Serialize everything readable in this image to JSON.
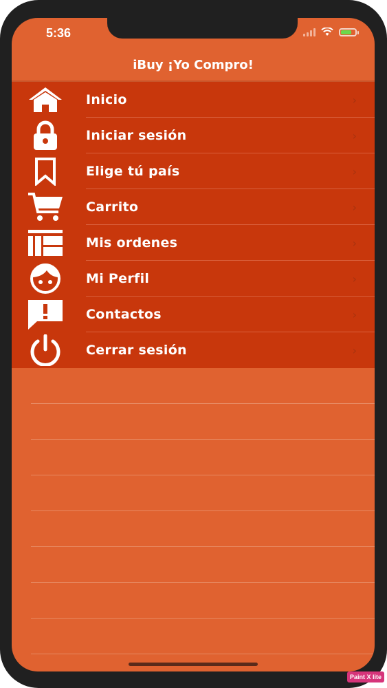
{
  "status_bar": {
    "time": "5:36"
  },
  "nav": {
    "title": "iBuy ¡Yo Compro!"
  },
  "menu": {
    "items": [
      {
        "label": "Inicio",
        "icon": "home-icon"
      },
      {
        "label": "Iniciar sesión",
        "icon": "lock-icon"
      },
      {
        "label": "Elige tú país",
        "icon": "bookmark-icon"
      },
      {
        "label": "Carrito",
        "icon": "cart-icon"
      },
      {
        "label": "Mis ordenes",
        "icon": "orders-icon"
      },
      {
        "label": "Mi Perfil",
        "icon": "profile-face-icon"
      },
      {
        "label": "Contactos",
        "icon": "chat-alert-icon"
      },
      {
        "label": "Cerrar sesión",
        "icon": "power-icon"
      }
    ],
    "chevron": "›"
  },
  "watermark": {
    "text": "Paint X lite"
  },
  "colors": {
    "nav_background": "#e06230",
    "menu_background": "#c8370c",
    "empty_background": "#e06230",
    "text": "#ffffff"
  },
  "battery_level": 0.85
}
